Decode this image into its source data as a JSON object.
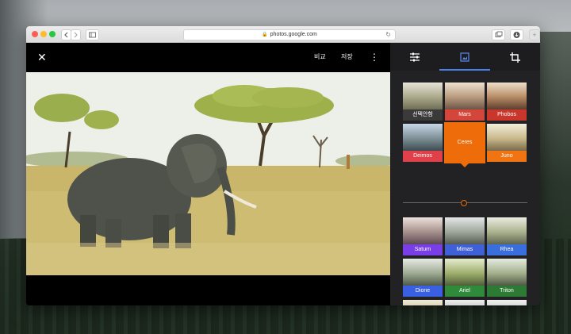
{
  "browser": {
    "url": "photos.google.com",
    "back_icon": "chevron-left",
    "forward_icon": "chevron-right",
    "sidebar_icon": "sidebar",
    "reload_icon": "reload",
    "tabs_icon": "tabs",
    "download_icon": "download"
  },
  "editor": {
    "compare_label": "비교",
    "save_label": "저장",
    "close_icon": "close",
    "more_icon": "more-vert"
  },
  "panel": {
    "tabs": [
      {
        "icon": "tune-icon",
        "active": false
      },
      {
        "icon": "filter-icon",
        "active": true
      },
      {
        "icon": "crop-icon",
        "active": false
      }
    ],
    "filters": [
      {
        "label": "선택안함",
        "color": "#3a3a3a"
      },
      {
        "label": "Mars",
        "color": "#d4453a"
      },
      {
        "label": "Phobos",
        "color": "#c8362c"
      },
      {
        "label": "Deimos",
        "color": "#e0404a"
      },
      {
        "label": "Ceres",
        "color": "#ef6c0a"
      },
      {
        "label": "Juno",
        "color": "#f07412"
      },
      {
        "label": "Saturn",
        "color": "#7a3ee6"
      },
      {
        "label": "Mimas",
        "color": "#4060d8"
      },
      {
        "label": "Rhea",
        "color": "#3a6edc"
      },
      {
        "label": "Dione",
        "color": "#3a5fe0"
      },
      {
        "label": "Ariel",
        "color": "#2f8a3a"
      },
      {
        "label": "Triton",
        "color": "#2d7a34"
      }
    ],
    "selected_filter": "Ceres",
    "intensity": 0.5
  }
}
